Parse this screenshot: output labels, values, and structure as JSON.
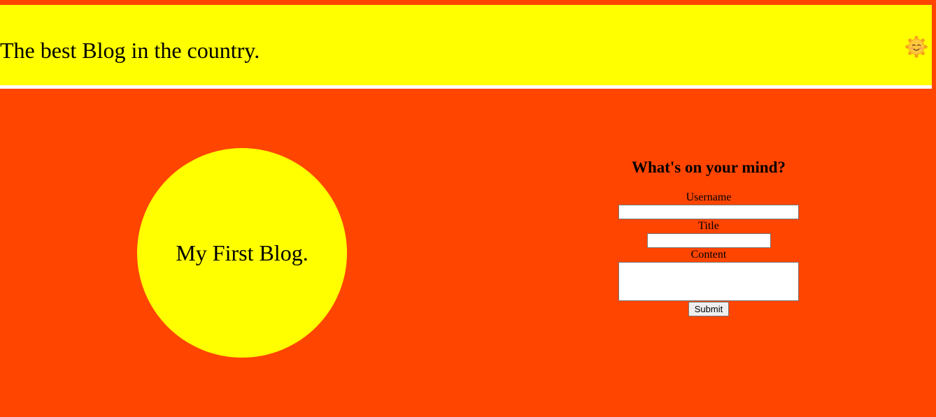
{
  "header": {
    "title": "The best Blog in the country.",
    "icon": "smiling-sun-icon"
  },
  "hero": {
    "circle_text": "My First Blog."
  },
  "form": {
    "heading": "What's on your mind?",
    "username_label": "Username",
    "username_value": "",
    "title_label": "Title",
    "title_value": "",
    "content_label": "Content",
    "content_value": "",
    "submit_label": "Submit"
  },
  "colors": {
    "background": "#ff4500",
    "accent": "#ffff00",
    "divider": "#ffffff"
  }
}
